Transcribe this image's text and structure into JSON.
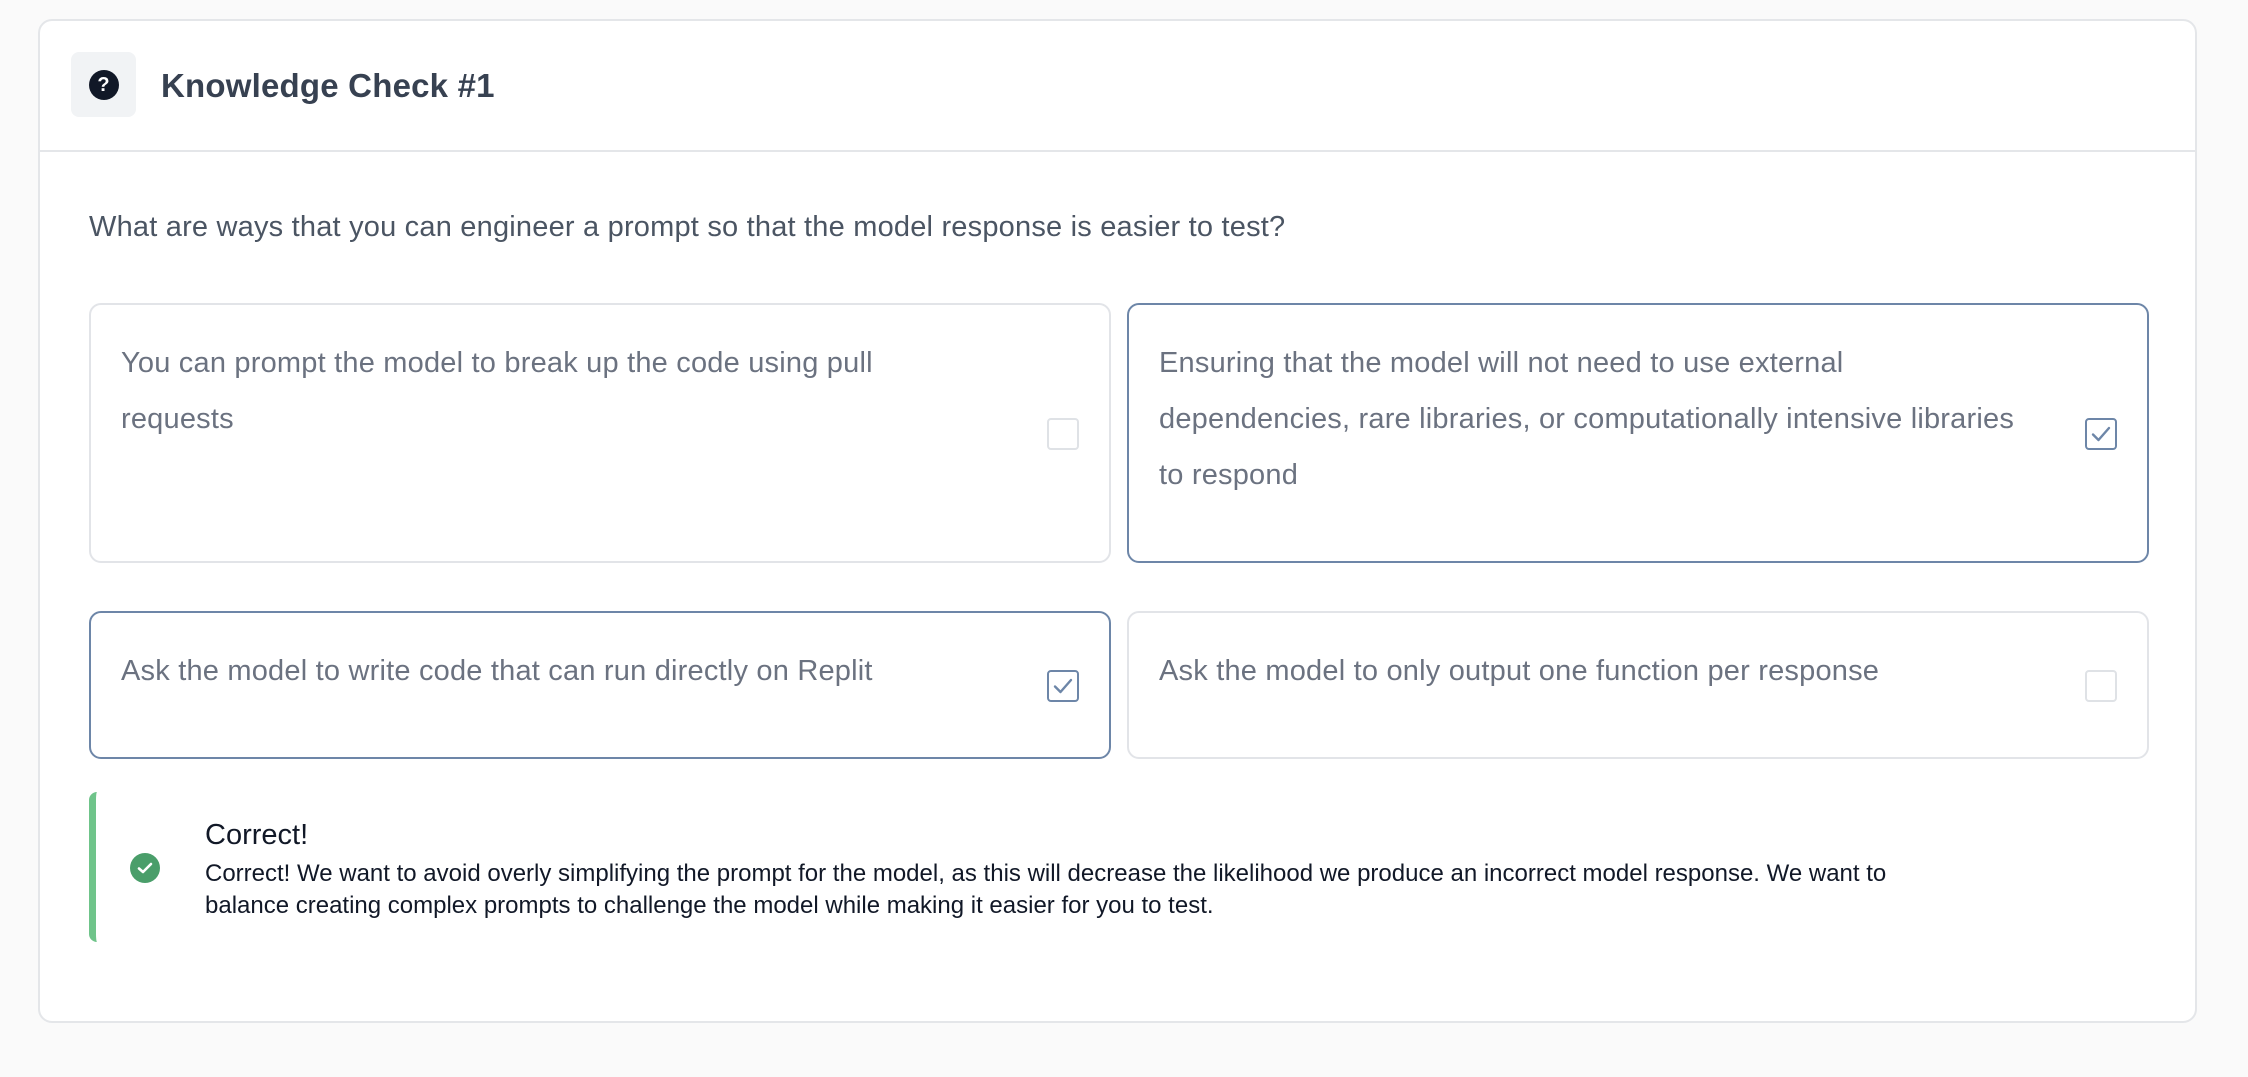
{
  "header": {
    "icon": "question-circle-icon",
    "title": "Knowledge Check #1"
  },
  "question": "What are ways that you can engineer a prompt so that the model response is easier to test?",
  "options": [
    {
      "lines": [
        "You can prompt the model to break up the code using pull",
        "requests"
      ],
      "checked": false
    },
    {
      "lines": [
        "Ensuring that the model will not need to use external",
        "dependencies, rare libraries, or computationally intensive libraries",
        "to respond"
      ],
      "checked": true
    },
    {
      "lines": [
        "Ask the model to write code that can run directly on Replit"
      ],
      "checked": true
    },
    {
      "lines": [
        "Ask the model to only output one function per response"
      ],
      "checked": false
    }
  ],
  "feedback": {
    "icon": "check-circle-icon",
    "title": "Correct!",
    "lines": [
      "Correct! We want to avoid overly simplifying the prompt for the model, as this will decrease the likelihood we produce an incorrect model response. We want to",
      "balance creating complex prompts to challenge the model while making it easier for you to test."
    ]
  },
  "colors": {
    "selected_border": "#6d86a8",
    "success_accent": "#6fc48a",
    "success_icon": "#4a9e6a"
  }
}
